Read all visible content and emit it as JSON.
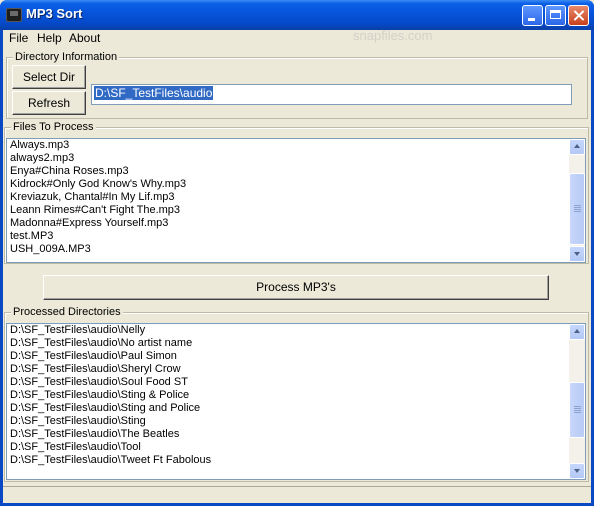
{
  "window": {
    "title": "MP3 Sort",
    "accent": "#0a49c4"
  },
  "menu": [
    "File",
    "Help",
    "About"
  ],
  "watermark": "snapfiles.com",
  "directory_info": {
    "legend": "Directory Information",
    "select_dir_label": "Select Dir",
    "refresh_label": "Refresh",
    "path_value": "D:\\SF_TestFiles\\audio"
  },
  "files_to_process": {
    "legend": "Files To Process",
    "items": [
      "Always.mp3",
      "always2.mp3",
      "Enya#China Roses.mp3",
      "Kidrock#Only God Know's Why.mp3",
      "Kreviazuk, Chantal#In My Lif.mp3",
      "Leann Rimes#Can't Fight The.mp3",
      "Madonna#Express Yourself.mp3",
      "test.MP3",
      "USH_009A.MP3"
    ]
  },
  "process_button_label": "Process MP3's",
  "processed_directories": {
    "legend": "Processed Directories",
    "items": [
      "D:\\SF_TestFiles\\audio\\Nelly",
      "D:\\SF_TestFiles\\audio\\No artist name",
      "D:\\SF_TestFiles\\audio\\Paul Simon",
      "D:\\SF_TestFiles\\audio\\Sheryl Crow",
      "D:\\SF_TestFiles\\audio\\Soul Food ST",
      "D:\\SF_TestFiles\\audio\\Sting & Police",
      "D:\\SF_TestFiles\\audio\\Sting and Police",
      "D:\\SF_TestFiles\\audio\\Sting",
      "D:\\SF_TestFiles\\audio\\The Beatles",
      "D:\\SF_TestFiles\\audio\\Tool",
      "D:\\SF_TestFiles\\audio\\Tweet Ft Fabolous"
    ]
  }
}
